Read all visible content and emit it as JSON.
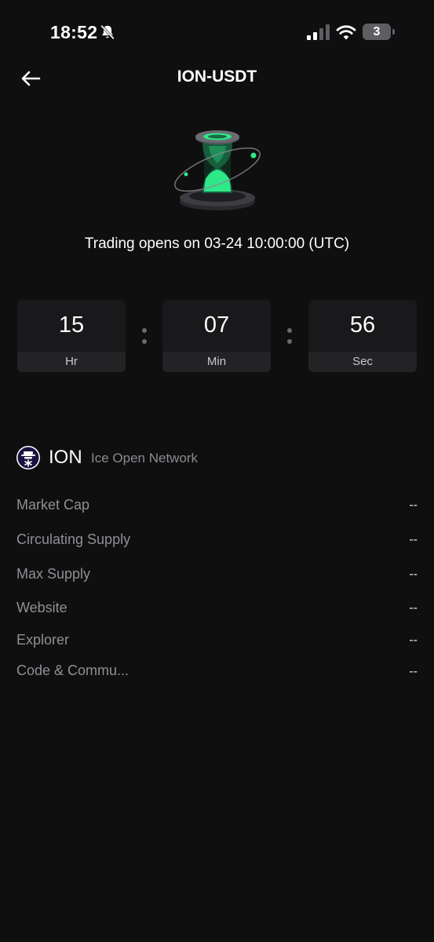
{
  "status_bar": {
    "time": "18:52",
    "battery_level": "3",
    "icons": [
      "bell-slash-icon",
      "cellular-signal-icon",
      "wifi-icon",
      "battery-icon"
    ]
  },
  "header": {
    "title": "ION-USDT",
    "back_icon": "arrow-left-icon"
  },
  "hero": {
    "illustration": "hourglass-icon",
    "opens_text": "Trading opens on 03-24 10:00:00 (UTC)"
  },
  "countdown": [
    {
      "value": "15",
      "unit": "Hr"
    },
    {
      "value": "07",
      "unit": "Min"
    },
    {
      "value": "56",
      "unit": "Sec"
    }
  ],
  "coin": {
    "symbol": "ION",
    "name": "Ice Open Network",
    "logo_icon": "ice-network-logo-icon"
  },
  "info_rows": [
    {
      "label": "Market Cap",
      "value": "--"
    },
    {
      "label": "Circulating Supply",
      "value": "--"
    },
    {
      "label": "Max Supply",
      "value": "--"
    },
    {
      "label": "Website",
      "value": "--"
    },
    {
      "label": "Explorer",
      "value": "--"
    },
    {
      "label": "Code & Commu...",
      "value": "--"
    }
  ],
  "colors": {
    "background": "#0f0f10",
    "accent_green": "#2ee88a",
    "label_gray": "#8f8f95"
  }
}
